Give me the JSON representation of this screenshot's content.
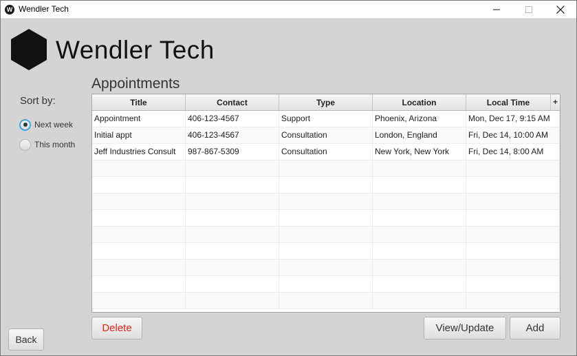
{
  "window": {
    "title": "Wendler Tech",
    "icon_letter": "W"
  },
  "header": {
    "brand": "Wendler Tech"
  },
  "section": {
    "title": "Appointments"
  },
  "sort": {
    "label": "Sort by:",
    "options": [
      {
        "label": "Next week",
        "selected": true
      },
      {
        "label": "This month",
        "selected": false
      }
    ]
  },
  "table": {
    "columns": [
      "Title",
      "Contact",
      "Type",
      "Location",
      "Local Time"
    ],
    "menu_glyph": "+",
    "rows": [
      {
        "title": "Appointment",
        "contact": "406-123-4567",
        "type": "Support",
        "location": "Phoenix, Arizona",
        "local_time": "Mon, Dec 17, 9:15 AM"
      },
      {
        "title": "Initial appt",
        "contact": "406-123-4567",
        "type": "Consultation",
        "location": "London, England",
        "local_time": "Fri, Dec 14, 10:00 AM"
      },
      {
        "title": "Jeff Industries Consult",
        "contact": "987-867-5309",
        "type": "Consultation",
        "location": "New York, New York",
        "local_time": "Fri, Dec 14, 8:00 AM"
      }
    ]
  },
  "buttons": {
    "delete": "Delete",
    "view_update": "View/Update",
    "add": "Add",
    "back": "Back"
  },
  "colors": {
    "accent": "#3fa3e0",
    "danger": "#e0241c",
    "background": "#d4d4d4"
  },
  "icons": {
    "minimize": "minimize-icon",
    "maximize": "maximize-icon",
    "close": "close-icon",
    "logo": "hexagon-logo-icon"
  }
}
